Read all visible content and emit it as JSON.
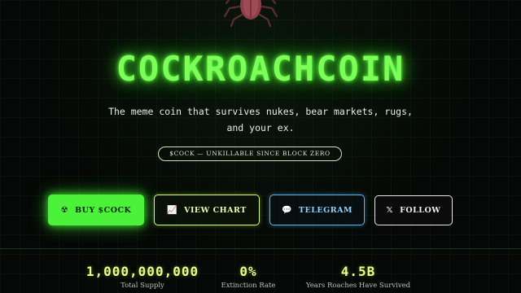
{
  "brand": {
    "title": "COCKROACHCOIN",
    "tagline_line1": "The meme coin that survives nukes, bear markets, rugs,",
    "tagline_line2": "and your ex.",
    "ticker_badge": "$COCK — UNKILLABLE SINCE BLOCK ZERO",
    "mascot_icon": "cockroach-icon"
  },
  "actions": {
    "buy": {
      "icon": "☢",
      "icon_name": "radioactive-icon",
      "label": "BUY $COCK"
    },
    "chart": {
      "icon": "📈",
      "icon_name": "chart-icon",
      "label": "VIEW CHART"
    },
    "telegram": {
      "icon": "💬",
      "icon_name": "speech-bubble-icon",
      "label": "TELEGRAM"
    },
    "follow": {
      "icon": "𝕏",
      "icon_name": "x-logo-icon",
      "label": "FOLLOW"
    }
  },
  "stats": [
    {
      "value": "1,000,000,000",
      "label": "Total Supply"
    },
    {
      "value": "0%",
      "label": "Extinction Rate"
    },
    {
      "value": "4.5B",
      "label": "Years Roaches Have Survived"
    }
  ],
  "colors": {
    "accent_green": "#7dff5a",
    "buy_button": "#4cf23a",
    "chart_border": "#d8ff7a",
    "telegram_border": "#57b9f0",
    "stat_value": "#e6ff8a",
    "background": "#050806"
  }
}
